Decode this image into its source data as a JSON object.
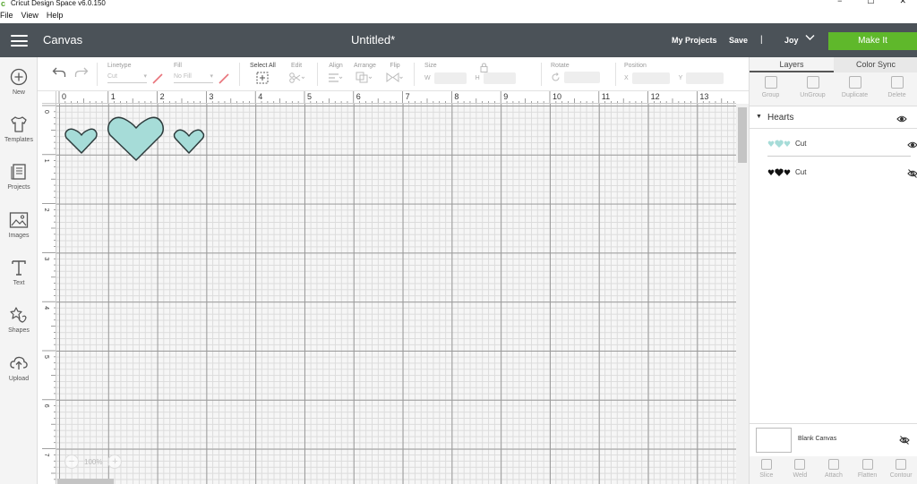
{
  "window": {
    "logo": "c",
    "title": "Cricut Design Space  v6.0.150",
    "controls": [
      "−",
      "☐",
      "✕"
    ]
  },
  "menu": [
    "File",
    "View",
    "Help"
  ],
  "header": {
    "section": "Canvas",
    "doc_title": "Untitled*",
    "my_projects": "My Projects",
    "save": "Save",
    "separator": "|",
    "user": "Joy",
    "make_it": "Make It",
    "accent": "#5fb82b",
    "bg": "#4b5258"
  },
  "sidebar": [
    {
      "label": "New",
      "icon": "plus-circle-icon"
    },
    {
      "label": "Templates",
      "icon": "tshirt-icon"
    },
    {
      "label": "Projects",
      "icon": "projects-icon"
    },
    {
      "label": "Images",
      "icon": "image-icon"
    },
    {
      "label": "Text",
      "icon": "text-icon"
    },
    {
      "label": "Shapes",
      "icon": "shapes-icon"
    },
    {
      "label": "Upload",
      "icon": "cloud-upload-icon"
    }
  ],
  "toolbar": {
    "linetype_label": "Linetype",
    "linetype_value": "Cut",
    "fill_label": "Fill",
    "fill_value": "No Fill",
    "select_all": "Select All",
    "edit": "Edit",
    "align": "Align",
    "arrange": "Arrange",
    "flip": "Flip",
    "size": "Size",
    "w": "W",
    "h": "H",
    "rotate": "Rotate",
    "position": "Position",
    "x": "X",
    "y": "Y"
  },
  "ruler": {
    "h": [
      "0",
      "1",
      "2",
      "3",
      "4",
      "5",
      "6",
      "7",
      "8",
      "9",
      "10",
      "11",
      "12",
      "13"
    ],
    "v": [
      "0",
      "1",
      "2",
      "3",
      "4",
      "5",
      "6",
      "7"
    ]
  },
  "zoom": {
    "minus": "−",
    "value": "100%",
    "plus": "+"
  },
  "right_panel": {
    "tabs": [
      "Layers",
      "Color Sync"
    ],
    "tools": [
      "Group",
      "UnGroup",
      "Duplicate",
      "Delete"
    ],
    "group_name": "Hearts",
    "layers": [
      {
        "name": "Cut",
        "color": "#a6dcd8",
        "visible": true
      },
      {
        "name": "Cut",
        "color": "#111111",
        "visible": false
      }
    ],
    "blank_canvas": "Blank Canvas",
    "bottom_tools": [
      "Slice",
      "Weld",
      "Attach",
      "Flatten",
      "Contour"
    ]
  },
  "heart_fill": "#a6dcd8",
  "heart_stroke": "#2d3b3c"
}
